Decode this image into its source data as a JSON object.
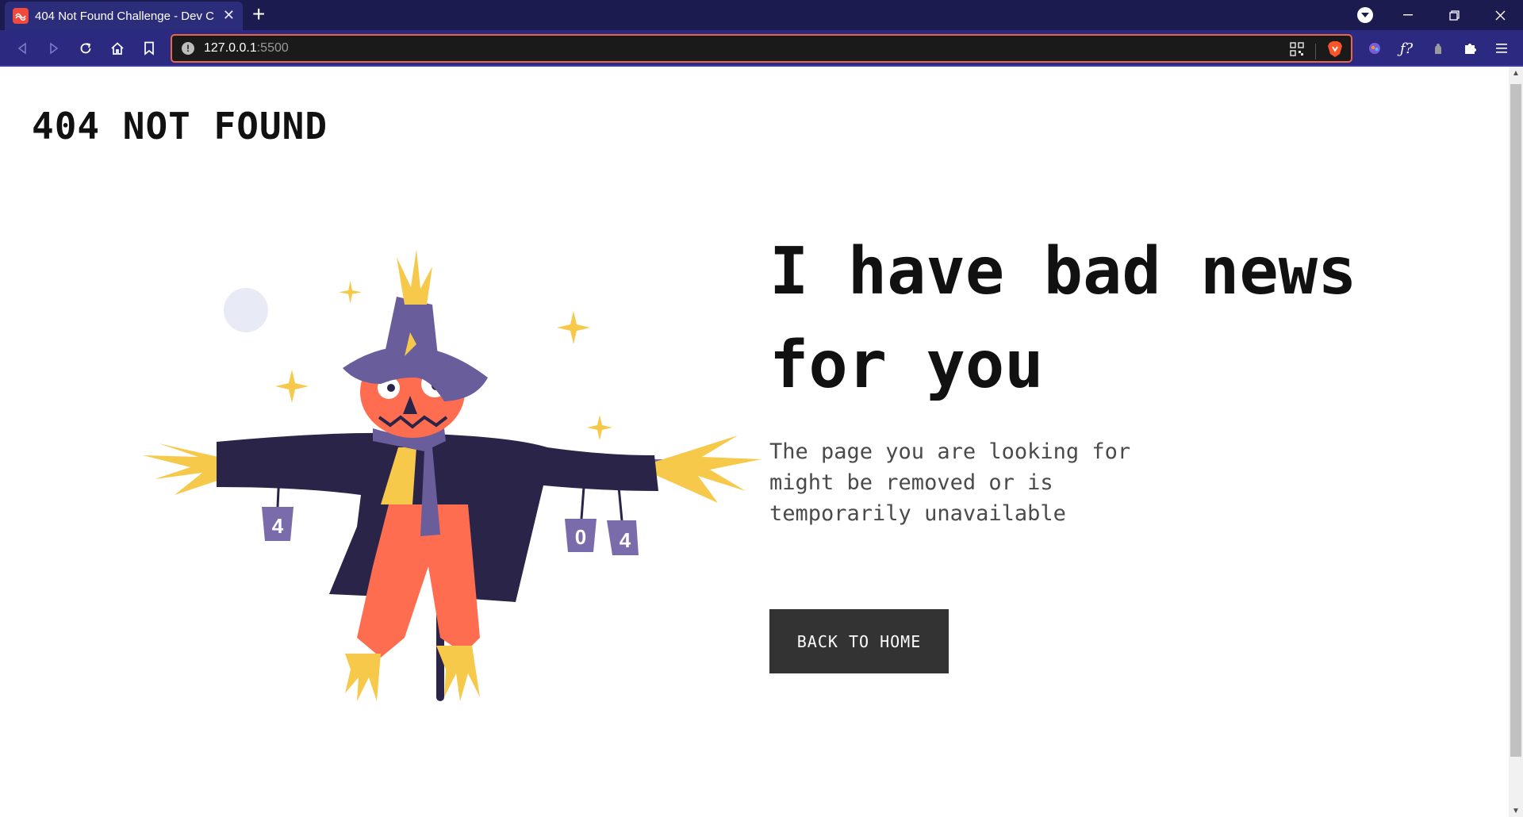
{
  "browser": {
    "tab_title": "404 Not Found Challenge - Dev C",
    "url_host": "127.0.0.1",
    "url_port": ":5500",
    "accent": "#f14a3c"
  },
  "page": {
    "brand": "404 NOT FOUND",
    "headline": "I have bad news for you",
    "description": "The page you are looking for might be removed or is temporarily unavailable",
    "button_label": "BACK TO HOME",
    "can_labels": [
      "4",
      "0",
      "4"
    ]
  }
}
